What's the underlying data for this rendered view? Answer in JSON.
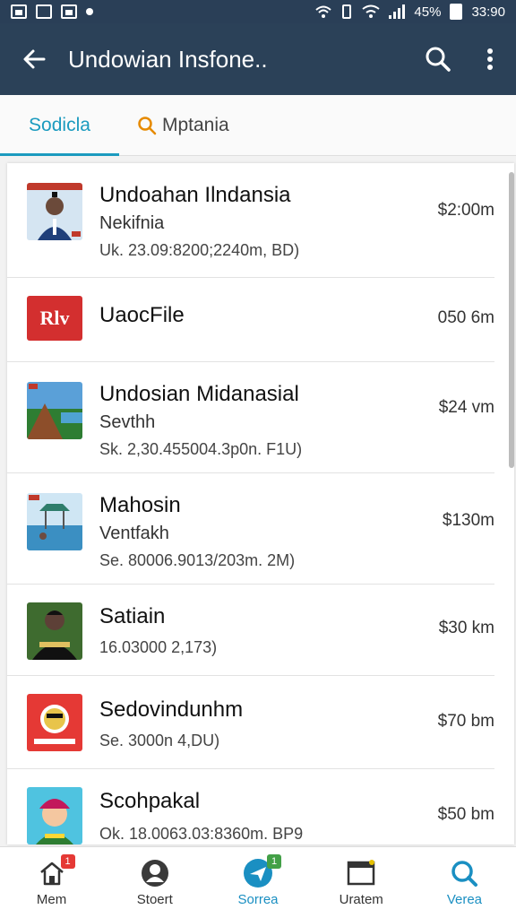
{
  "status_bar": {
    "battery_text": "45%",
    "time": "33:90"
  },
  "appbar": {
    "title": "Undowian Insfone.."
  },
  "tabs": [
    {
      "label": "Sodicla",
      "active": true
    },
    {
      "label": "Mptania",
      "active": false
    }
  ],
  "list": [
    {
      "name": "Undoahan Ilndansia",
      "sub": "Nekifnia",
      "meta": "Uk. 23.09:8200;2240m, BD)",
      "size": "$2:00m",
      "thumb_icon": "person-thumbnail"
    },
    {
      "name": "UaocFile",
      "sub": "",
      "meta": "",
      "size": "050 6m",
      "thumb_icon": "red-logo-thumbnail",
      "thumb_text": "Rlv"
    },
    {
      "name": "Undosian Midanasial",
      "sub": "Sevthh",
      "meta": "Sk. 2,30.455004.3p0n. F1U)",
      "size": "$24 vm",
      "thumb_icon": "landscape-thumbnail"
    },
    {
      "name": "Mahosin",
      "sub": "Ventfakh",
      "meta": "Se. 80006.9013/203m. 2M)",
      "size": "$130m",
      "thumb_icon": "beach-thumbnail"
    },
    {
      "name": "Satiain",
      "sub": "",
      "meta": "16.03000 2,173)",
      "size": "$30 km",
      "thumb_icon": "person-shirt-thumbnail"
    },
    {
      "name": "Sedovindunhm",
      "sub": "",
      "meta": "Se. 3000n 4,DU)",
      "size": "$70 bm",
      "thumb_icon": "character-red-thumbnail"
    },
    {
      "name": "Scohpakal",
      "sub": "",
      "meta": "Ok. 18.0063.03:8360m. BP9",
      "size": "$50 bm",
      "thumb_icon": "cartoon-kid-thumbnail"
    }
  ],
  "bottom_nav": [
    {
      "label": "Mem",
      "icon": "home-icon",
      "badge": "1"
    },
    {
      "label": "Stoert",
      "icon": "profile-icon",
      "badge": ""
    },
    {
      "label": "Sorrea",
      "icon": "send-icon",
      "badge": "1",
      "active": true
    },
    {
      "label": "Uratem",
      "icon": "window-icon",
      "badge": ""
    },
    {
      "label": "Verea",
      "icon": "search-icon",
      "badge": "",
      "active": true
    }
  ],
  "colors": {
    "appbar": "#2b4158",
    "accent": "#1b9bbf",
    "badge_red": "#e53935",
    "badge_green": "#43a047"
  }
}
